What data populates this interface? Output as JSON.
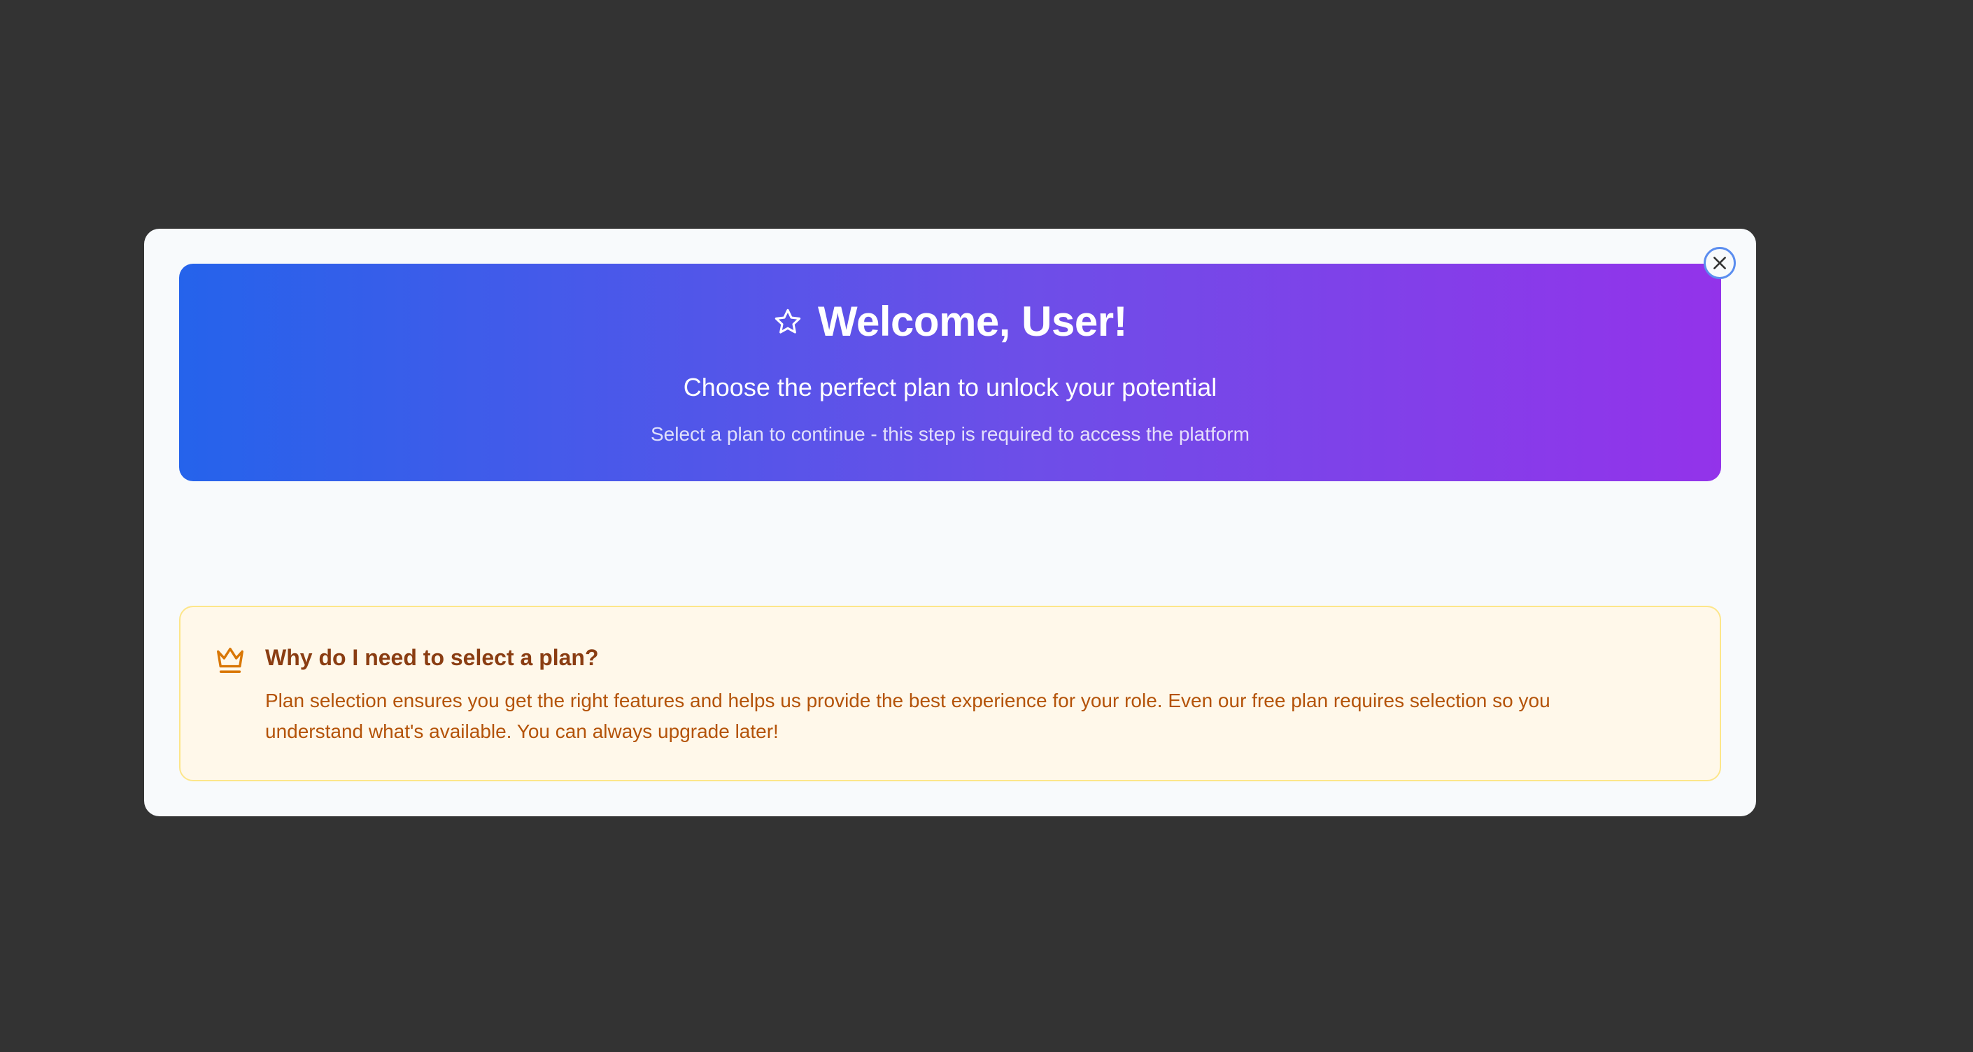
{
  "modal": {
    "close_label": "Close"
  },
  "hero": {
    "title": "Welcome, User!",
    "subtitle": "Choose the perfect plan to unlock your potential",
    "note": "Select a plan to continue - this step is required to access the platform",
    "icon": "star-icon",
    "gradient_start": "#2563eb",
    "gradient_end": "#9333ea"
  },
  "info": {
    "icon": "crown-icon",
    "title": "Why do I need to select a plan?",
    "text": "Plan selection ensures you get the right features and helps us provide the best experience for your role. Even our free plan requires selection so you understand what's available. You can always upgrade later!",
    "accent": "#b45309"
  }
}
